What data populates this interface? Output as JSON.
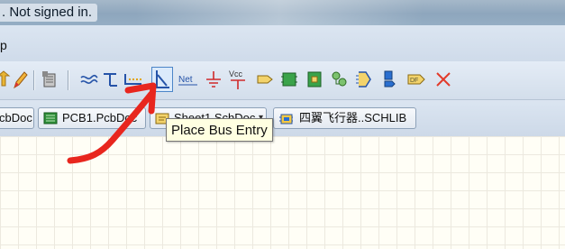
{
  "window": {
    "title": ". Not signed in."
  },
  "menu": {
    "first_item_fragment": "p"
  },
  "toolbar": {
    "tooltip": "Place Bus Entry",
    "buttons": [
      {
        "icon": "arrow-icon"
      },
      {
        "icon": "pencil-icon"
      },
      {
        "icon": "part-icon"
      },
      {
        "icon": "wire-icon"
      },
      {
        "icon": "bus-icon"
      },
      {
        "icon": "signal-harness-icon"
      },
      {
        "icon": "bus-entry-icon",
        "active": true
      },
      {
        "icon": "net-label-icon",
        "label": "Net"
      },
      {
        "icon": "ground-icon"
      },
      {
        "icon": "vcc-icon",
        "label": "Vcc"
      },
      {
        "icon": "port-icon"
      },
      {
        "icon": "sheet-symbol-icon"
      },
      {
        "icon": "sheet-entry-icon"
      },
      {
        "icon": "device-sheet-icon"
      },
      {
        "icon": "harness-connector-icon"
      },
      {
        "icon": "harness-entry-icon"
      },
      {
        "icon": "directive-icon",
        "label": "DF"
      },
      {
        "icon": "no-erc-icon"
      }
    ]
  },
  "tabs": [
    {
      "icon": "pcb-doc-icon",
      "label": "cbDoc"
    },
    {
      "icon": "pcb-doc-icon",
      "label": "PCB1.PcbDoc"
    },
    {
      "icon": "schematic-doc-icon",
      "label": "Sheet1.SchDoc",
      "has_dropdown": true
    },
    {
      "icon": "schlib-icon",
      "label": "四翼飞行器..SCHLIB"
    }
  ],
  "colors": {
    "annotation_arrow": "#e8261e",
    "active_button_border": "#4c86c8"
  }
}
